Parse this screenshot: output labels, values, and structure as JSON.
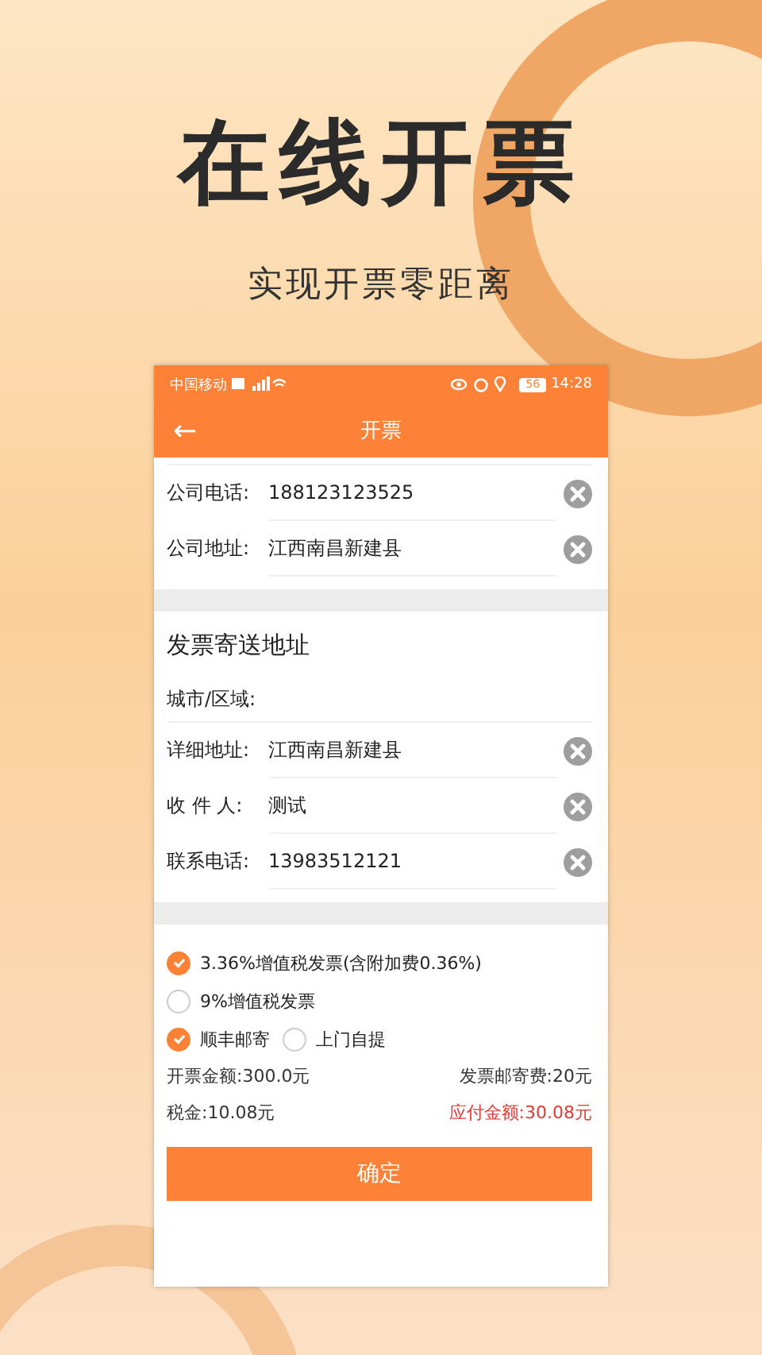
{
  "headline": "在线开票",
  "subtitle": "实现开票零距离",
  "status_bar": {
    "carrier": "中国移动",
    "battery": "56",
    "time": "14:28"
  },
  "nav": {
    "back": "←",
    "title": "开票"
  },
  "company_fields": [
    {
      "label": "公司电话:",
      "value": "188123123525"
    },
    {
      "label": "公司地址:",
      "value": "江西南昌新建县"
    }
  ],
  "mailing": {
    "title": "发票寄送地址",
    "city_label": "城市/区域:",
    "fields": [
      {
        "label": "详细地址:",
        "value": "江西南昌新建县"
      },
      {
        "label": "收 件 人:",
        "value": "测试"
      },
      {
        "label": "联系电话:",
        "value": "13983512121"
      }
    ]
  },
  "invoice_types": [
    {
      "label": "3.36%增值税发票(含附加费0.36%)",
      "selected": true
    },
    {
      "label": "9%增值税发票",
      "selected": false
    }
  ],
  "delivery": [
    {
      "label": "顺丰邮寄",
      "selected": true
    },
    {
      "label": "上门自提",
      "selected": false
    }
  ],
  "amounts": [
    {
      "text": "开票金额:300.0元",
      "highlight": false
    },
    {
      "text": "发票邮寄费:20元",
      "highlight": false
    },
    {
      "text": "税金:10.08元",
      "highlight": false
    },
    {
      "text": "应付金额:30.08元",
      "highlight": true
    }
  ],
  "confirm_button": "确定"
}
